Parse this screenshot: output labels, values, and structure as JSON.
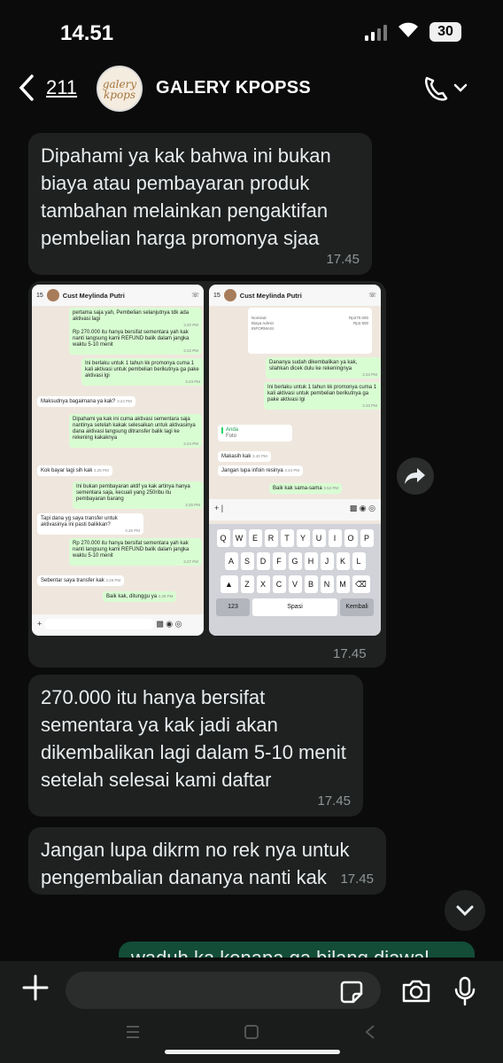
{
  "status": {
    "time": "14.51",
    "battery": "30"
  },
  "header": {
    "back_count": "211",
    "avatar_text": "galery kpops",
    "title": "GALERY KPOPSS"
  },
  "messages": [
    {
      "text": "Dipahami ya kak bahwa ini bukan biaya atau pembayaran produk tambahan melainkan pengaktifan pembelian harga promonya sjaa",
      "time": "17.45"
    },
    {
      "time": "17.45"
    },
    {
      "text": "270.000 itu hanya bersifat sementara ya kak jadi akan dikembalikan lagi dalam 5-10 menit setelah selesai kami daftar",
      "time": "17.45"
    },
    {
      "text": "Jangan lupa dikrm no rek nya untuk pengembalian dananya nanti kak",
      "time": "17.45"
    },
    {
      "text": "waduh ka kenapa ga bilang diawal"
    }
  ],
  "shot1": {
    "back": "15",
    "name": "Cust Meylinda Putri",
    "msgs": [
      {
        "t": "pertama saja yah, Pembelian selanjutnya tdk ada aktivasi lagi",
        "ts": "3.20 PM"
      },
      {
        "t": "Rp 270.000 itu hanya bersifat sementara yah kak nanti langsung kami REFUND balik dalam jangka waktu 5-10 menit",
        "ts": "3.22 PM"
      },
      {
        "t": "Ini berlaku untuk 1 tahun kk promonya cuma 1 kali aktivasi untuk pembelian berikutnya ga pake aktivasi lgi",
        "ts": "3.23 PM"
      },
      {
        "t": "Maksudnya bagaimana ya kak?",
        "ts": "3.24 PM"
      },
      {
        "t": "Dipahami ya kak ini cuma aktivasi sementara saja nantinya setelah kakak selesaikan untuk aktivasinya dana aktivasi langsung ditransfer balik lagi ke rekening kakaknya",
        "ts": "3.24 PM"
      },
      {
        "t": "Kok bayar lagi sih kak",
        "ts": "3.25 PM"
      },
      {
        "t": "Ini bukan pembayaran aktif ya kak artinya hanya sementara saja, kecuali yang 250ribu itu pembayaran barang",
        "ts": "3.25 PM"
      },
      {
        "t": "Tapi dana yg saya transfer untuk aktivasinya ini pasti balikkan?",
        "ts": "3.26 PM"
      },
      {
        "t": "Rp 270.000 itu hanya bersifat sementara yah kak nanti langsung kami REFUND balik dalam jangka waktu 5-10 menit",
        "ts": "3.27 PM"
      },
      {
        "t": "Sebentar saya transfer kak",
        "ts": "3.28 PM"
      },
      {
        "t": "Baik kak, ditunggu ya",
        "ts": "3.28 PM"
      }
    ]
  },
  "shot2": {
    "back": "15",
    "name": "Cust Meylinda Putri",
    "receipt": {
      "row1_label": "Nominal",
      "row1_value": "Rp270.000",
      "row2_label": "Biaya Admin",
      "row2_value": "Rp2.500",
      "info": "INFORMASI"
    },
    "msgs": [
      {
        "t": "Dananya sudah dikembalikan ya kak, silahkan dicek dulu ke rekeningnya",
        "ts": "3.33 PM"
      },
      {
        "t": "Ini berlaku untuk 1 tahun kk promonya cuma 1 kali aktivasi untuk pembelian berikutnya ga pake aktivasi lgi",
        "ts": "3.33 PM"
      },
      {
        "t": "Anda",
        "ts": ""
      },
      {
        "t": "Foto",
        "ts": ""
      },
      {
        "t": "Makasih kak",
        "ts": "3.40 PM"
      },
      {
        "t": "Jangan lupa infoin resinya",
        "ts": "3.44 PM"
      },
      {
        "t": "Baik kak sama-sama",
        "ts": "3.52 PM"
      }
    ],
    "keys": {
      "row1": [
        "Q",
        "W",
        "E",
        "R",
        "T",
        "Y",
        "U",
        "I",
        "O",
        "P"
      ],
      "row2": [
        "A",
        "S",
        "D",
        "F",
        "G",
        "H",
        "J",
        "K",
        "L"
      ],
      "row3": [
        "Z",
        "X",
        "C",
        "V",
        "B",
        "N",
        "M"
      ],
      "num": "123",
      "space": "Spasi",
      "ret": "Kembali"
    }
  },
  "input": {
    "placeholder": ""
  },
  "colors": {
    "incoming": "#1f2121",
    "outgoing": "#134d37",
    "background": "#0b0b0b"
  }
}
